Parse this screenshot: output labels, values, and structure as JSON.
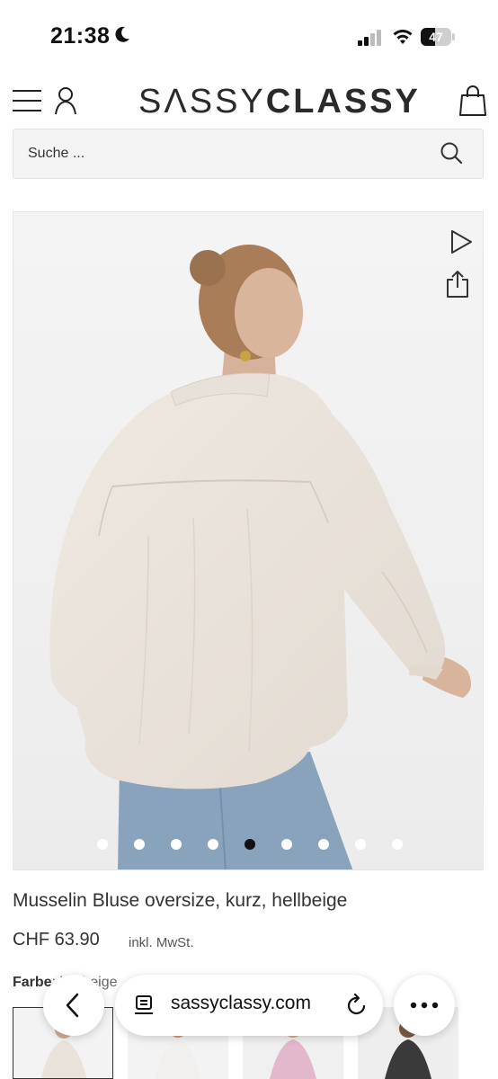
{
  "status_bar": {
    "time": "21:38",
    "battery_level": "47",
    "battery_fraction": 0.47
  },
  "header": {
    "logo_part1": "SΛSSY",
    "logo_part2": "CLASSY",
    "icons": [
      "menu-icon",
      "user-icon",
      "shopping-bag-icon"
    ]
  },
  "search": {
    "placeholder": "Suche ...",
    "value": ""
  },
  "gallery": {
    "image_count": 9,
    "active_index": 4,
    "icons": [
      "play-icon",
      "share-icon"
    ]
  },
  "product": {
    "title": "Musselin Bluse oversize, kurz, hellbeige",
    "price": "CHF 63.90",
    "tax_note": "inkl. MwSt.",
    "color_label": "Farbe",
    "color_value": "hellbeige"
  },
  "browser": {
    "url": "sassyclassy.com",
    "icons": [
      "back-icon",
      "reader-icon",
      "reload-icon",
      "more-icon"
    ]
  }
}
